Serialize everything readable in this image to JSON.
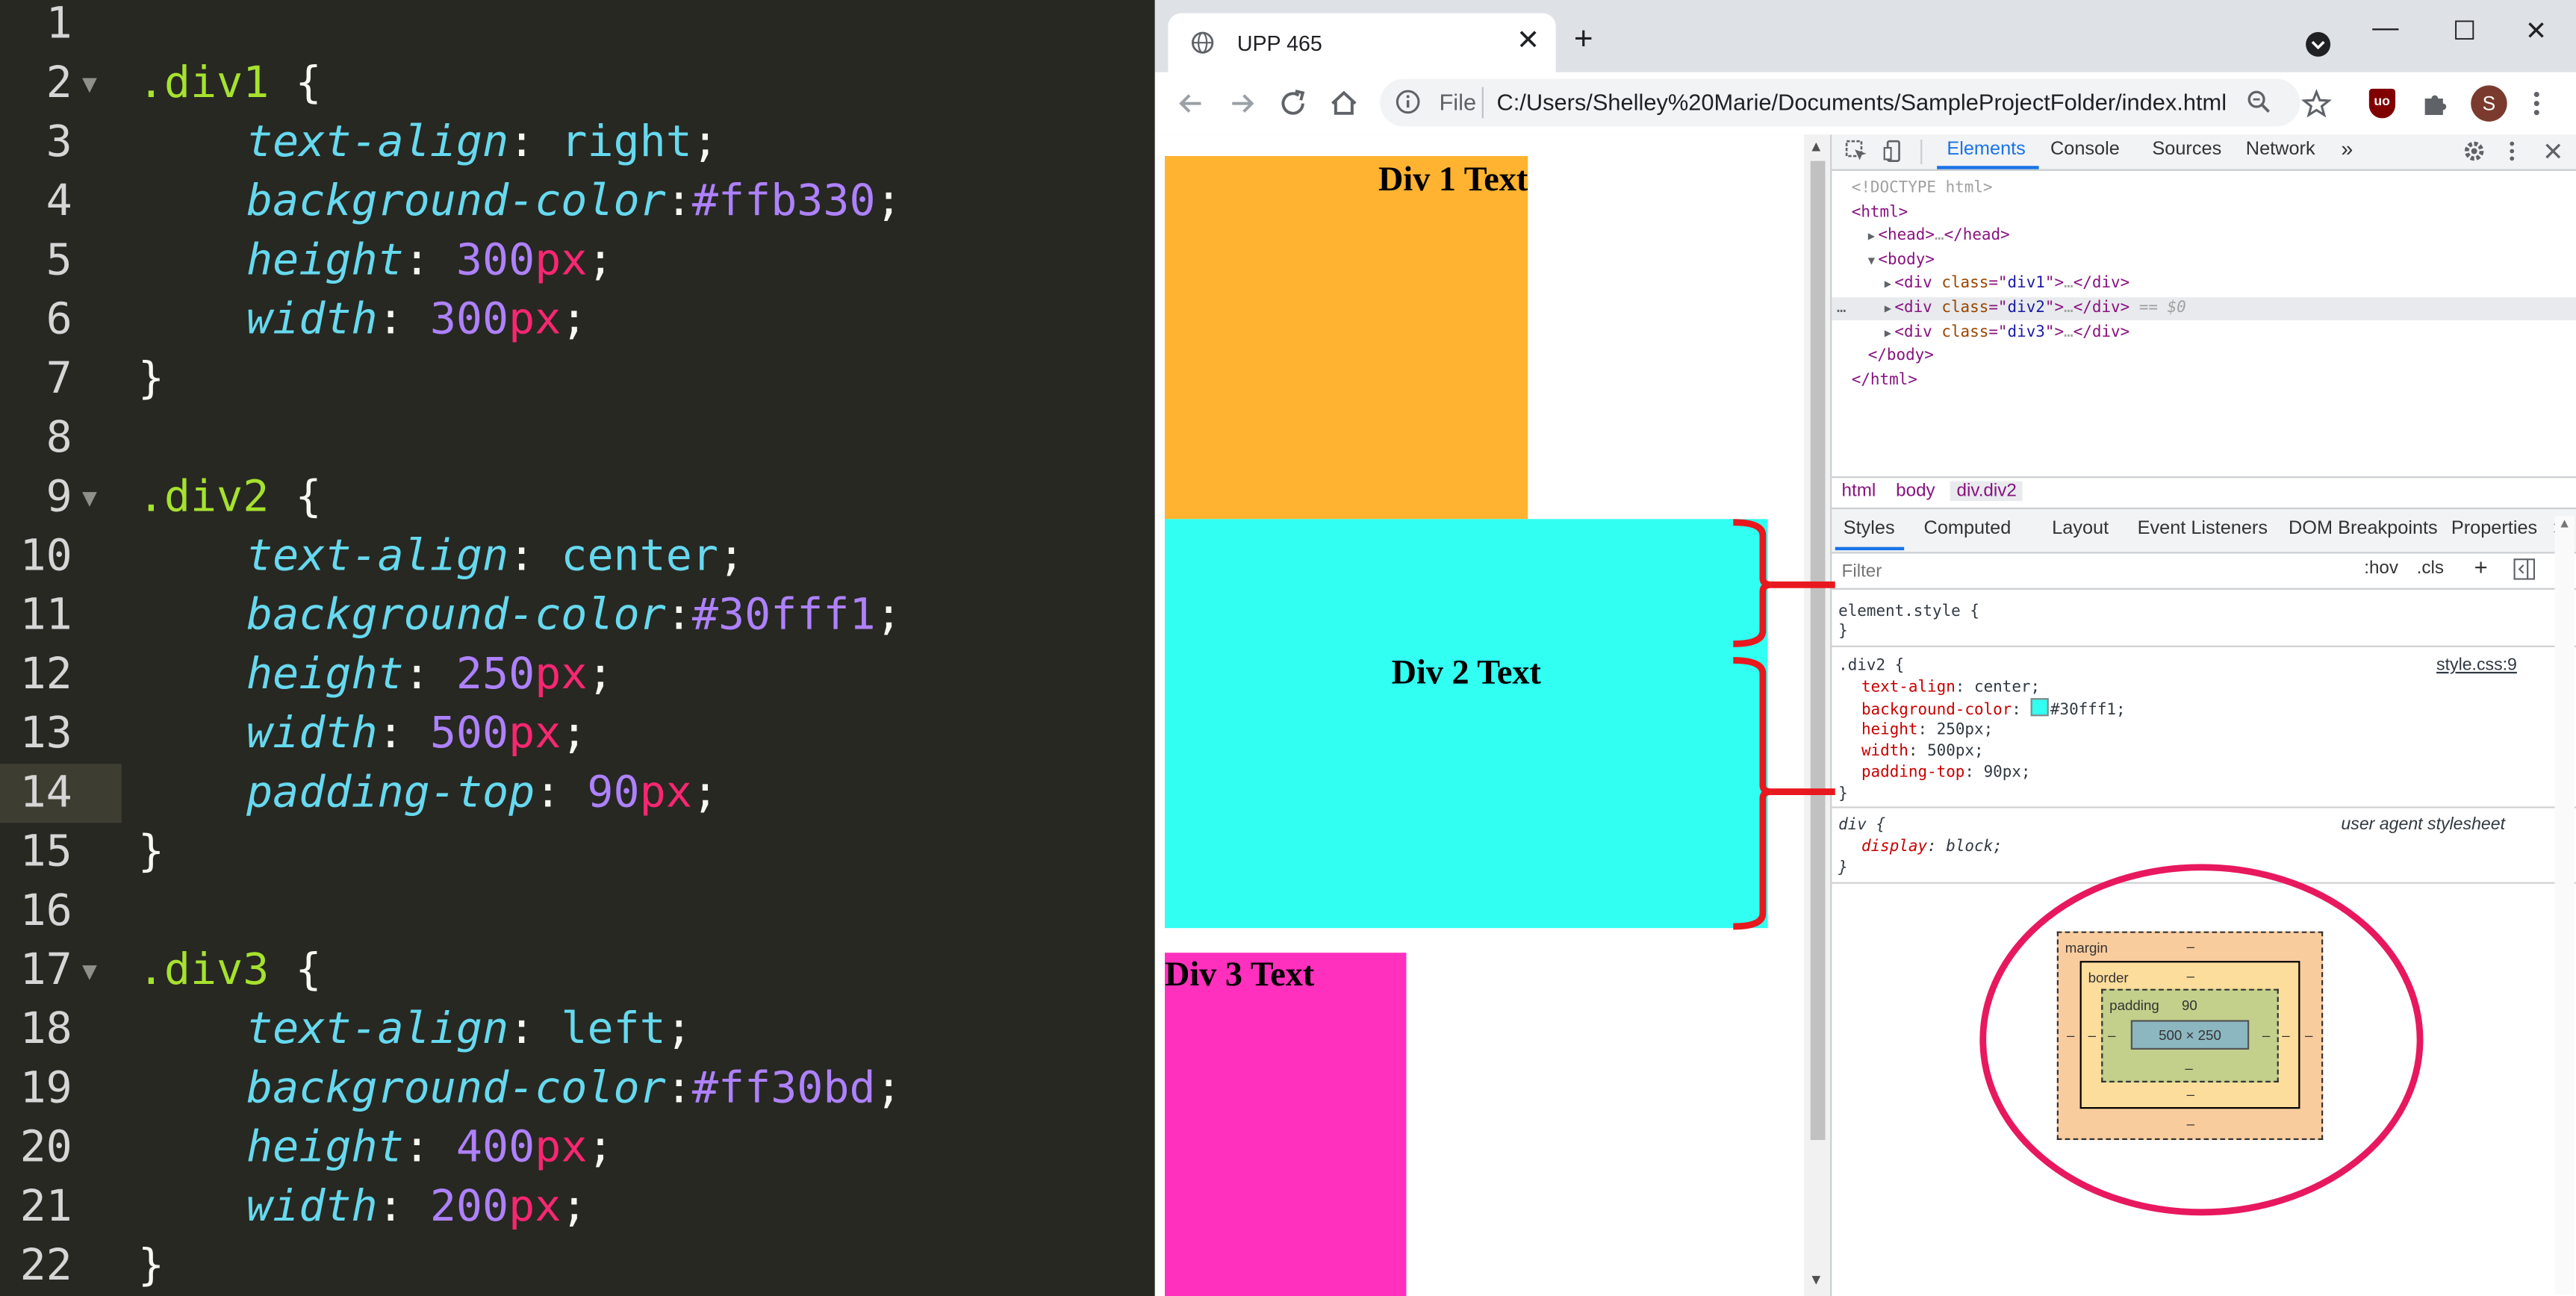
{
  "editor": {
    "current_line": 14,
    "lines": [
      {
        "n": "1",
        "parts": []
      },
      {
        "n": "2",
        "fold": true,
        "parts": [
          [
            "sel",
            ".div1"
          ],
          [
            "punc",
            " {"
          ]
        ]
      },
      {
        "n": "3",
        "parts": [
          [
            "prop",
            "text-align"
          ],
          [
            "punc",
            ": "
          ],
          [
            "val",
            "right"
          ],
          [
            "punc",
            ";"
          ]
        ]
      },
      {
        "n": "4",
        "parts": [
          [
            "prop",
            "background-color"
          ],
          [
            "punc",
            ":"
          ],
          [
            "num",
            "#ffb330"
          ],
          [
            "punc",
            ";"
          ]
        ]
      },
      {
        "n": "5",
        "parts": [
          [
            "prop",
            "height"
          ],
          [
            "punc",
            ": "
          ],
          [
            "num",
            "300"
          ],
          [
            "unit",
            "px"
          ],
          [
            "punc",
            ";"
          ]
        ]
      },
      {
        "n": "6",
        "parts": [
          [
            "prop",
            "width"
          ],
          [
            "punc",
            ": "
          ],
          [
            "num",
            "300"
          ],
          [
            "unit",
            "px"
          ],
          [
            "punc",
            ";"
          ]
        ]
      },
      {
        "n": "7",
        "parts": [
          [
            "punc",
            "}"
          ]
        ]
      },
      {
        "n": "8",
        "parts": []
      },
      {
        "n": "9",
        "fold": true,
        "parts": [
          [
            "sel",
            ".div2"
          ],
          [
            "punc",
            " {"
          ]
        ]
      },
      {
        "n": "10",
        "parts": [
          [
            "prop",
            "text-align"
          ],
          [
            "punc",
            ": "
          ],
          [
            "val",
            "center"
          ],
          [
            "punc",
            ";"
          ]
        ]
      },
      {
        "n": "11",
        "parts": [
          [
            "prop",
            "background-color"
          ],
          [
            "punc",
            ":"
          ],
          [
            "num",
            "#30fff1"
          ],
          [
            "punc",
            ";"
          ]
        ]
      },
      {
        "n": "12",
        "parts": [
          [
            "prop",
            "height"
          ],
          [
            "punc",
            ": "
          ],
          [
            "num",
            "250"
          ],
          [
            "unit",
            "px"
          ],
          [
            "punc",
            ";"
          ]
        ]
      },
      {
        "n": "13",
        "parts": [
          [
            "prop",
            "width"
          ],
          [
            "punc",
            ": "
          ],
          [
            "num",
            "500"
          ],
          [
            "unit",
            "px"
          ],
          [
            "punc",
            ";"
          ]
        ]
      },
      {
        "n": "14",
        "parts": [
          [
            "prop",
            "padding-top"
          ],
          [
            "punc",
            ": "
          ],
          [
            "num",
            "90"
          ],
          [
            "unit",
            "px"
          ],
          [
            "punc",
            ";"
          ]
        ]
      },
      {
        "n": "15",
        "parts": [
          [
            "punc",
            "}"
          ]
        ]
      },
      {
        "n": "16",
        "parts": []
      },
      {
        "n": "17",
        "fold": true,
        "parts": [
          [
            "sel",
            ".div3"
          ],
          [
            "punc",
            " {"
          ]
        ]
      },
      {
        "n": "18",
        "parts": [
          [
            "prop",
            "text-align"
          ],
          [
            "punc",
            ": "
          ],
          [
            "val",
            "left"
          ],
          [
            "punc",
            ";"
          ]
        ]
      },
      {
        "n": "19",
        "parts": [
          [
            "prop",
            "background-color"
          ],
          [
            "punc",
            ":"
          ],
          [
            "num",
            "#ff30bd"
          ],
          [
            "punc",
            ";"
          ]
        ]
      },
      {
        "n": "20",
        "parts": [
          [
            "prop",
            "height"
          ],
          [
            "punc",
            ": "
          ],
          [
            "num",
            "400"
          ],
          [
            "unit",
            "px"
          ],
          [
            "punc",
            ";"
          ]
        ]
      },
      {
        "n": "21",
        "parts": [
          [
            "prop",
            "width"
          ],
          [
            "punc",
            ": "
          ],
          [
            "num",
            "200"
          ],
          [
            "unit",
            "px"
          ],
          [
            "punc",
            ";"
          ]
        ]
      },
      {
        "n": "22",
        "parts": [
          [
            "punc",
            "}"
          ]
        ]
      }
    ]
  },
  "browser": {
    "tab_title": "UPP 465",
    "tab_close": "✕",
    "new_tab": "+",
    "window_buttons": [
      "—",
      "☐",
      "✕"
    ],
    "omnibox_scheme": "File",
    "url": "C:/Users/Shelley%20Marie/Documents/SampleProjectFolder/index.html",
    "profile_initial": "S",
    "extension_label": "uo"
  },
  "page": {
    "div1_text": "Div 1 Text",
    "div2_text": "Div 2 Text",
    "div3_text": "Div 3 Text",
    "colors": {
      "div1": "#ffb330",
      "div2": "#30fff1",
      "div3": "#ff30bd",
      "annotation": "#e8185e"
    }
  },
  "devtools": {
    "tabs": [
      "Elements",
      "Console",
      "Sources",
      "Network"
    ],
    "more": "»",
    "dom": [
      {
        "indent": 0,
        "parts": [
          [
            "cmt",
            "<!DOCTYPE html>"
          ]
        ]
      },
      {
        "indent": 0,
        "parts": [
          [
            "tag",
            "<html>"
          ]
        ]
      },
      {
        "indent": 1,
        "tri": "▶",
        "parts": [
          [
            "tag",
            "<head>"
          ],
          [
            "cmt",
            "…"
          ],
          [
            "tag",
            "</head>"
          ]
        ]
      },
      {
        "indent": 1,
        "tri": "▼",
        "parts": [
          [
            "tag",
            "<body>"
          ]
        ]
      },
      {
        "indent": 2,
        "tri": "▶",
        "parts": [
          [
            "tag",
            "<div "
          ],
          [
            "attr",
            "class"
          ],
          [
            "tag",
            "=\""
          ],
          [
            "aval",
            "div1"
          ],
          [
            "tag",
            "\">"
          ],
          [
            "cmt",
            "…"
          ],
          [
            "tag",
            "</div>"
          ]
        ]
      },
      {
        "indent": 2,
        "tri": "▶",
        "selected": true,
        "parts": [
          [
            "tag",
            "<div "
          ],
          [
            "attr",
            "class"
          ],
          [
            "tag",
            "=\""
          ],
          [
            "aval",
            "div2"
          ],
          [
            "tag",
            "\">"
          ],
          [
            "cmt",
            "…"
          ],
          [
            "tag",
            "</div>"
          ],
          [
            "cmt",
            " == $0"
          ]
        ]
      },
      {
        "indent": 2,
        "tri": "▶",
        "parts": [
          [
            "tag",
            "<div "
          ],
          [
            "attr",
            "class"
          ],
          [
            "tag",
            "=\""
          ],
          [
            "aval",
            "div3"
          ],
          [
            "tag",
            "\">"
          ],
          [
            "cmt",
            "…"
          ],
          [
            "tag",
            "</div>"
          ]
        ]
      },
      {
        "indent": 1,
        "parts": [
          [
            "tag",
            "</body>"
          ]
        ]
      },
      {
        "indent": 0,
        "parts": [
          [
            "tag",
            "</html>"
          ]
        ]
      }
    ],
    "breadcrumbs": [
      "html",
      "body",
      "div.div2"
    ],
    "sub_tabs": [
      "Styles",
      "Computed",
      "Layout",
      "Event Listeners",
      "DOM Breakpoints",
      "Properties"
    ],
    "filter_placeholder": "Filter",
    "filter_buttons": [
      ":hov",
      ".cls",
      "+"
    ],
    "element_style": "element.style {",
    "brace_close": "}",
    "rule_selector": ".div2 {",
    "rule_source": "style.css:9",
    "rule_props": [
      {
        "name": "text-align",
        "value": "center;"
      },
      {
        "name": "background-color",
        "value": "#30fff1;",
        "swatch": "#30fff1"
      },
      {
        "name": "height",
        "value": "250px;"
      },
      {
        "name": "width",
        "value": "500px;"
      },
      {
        "name": "padding-top",
        "value": "90px;"
      }
    ],
    "ua_selector": "div {",
    "ua_source": "user agent stylesheet",
    "ua_prop": {
      "name": "display",
      "value": "block;"
    },
    "box_model": {
      "margin_label": "margin",
      "border_label": "border",
      "padding_label": "padding",
      "padding_top": "90",
      "content": "500 × 250",
      "dash": "–"
    }
  }
}
